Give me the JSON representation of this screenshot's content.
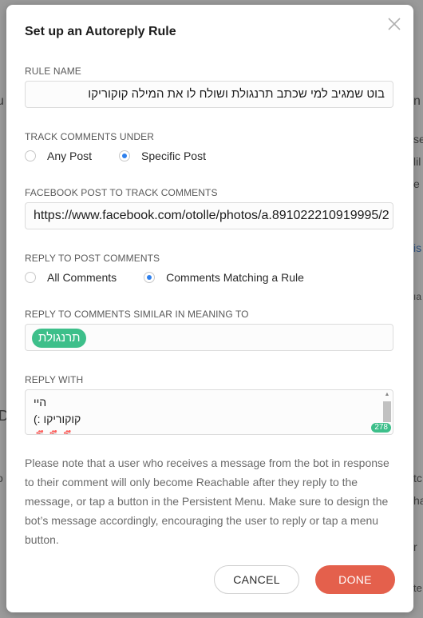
{
  "background_fragments": {
    "f1": "u",
    "f2": "n",
    "f3": "se",
    "f4": "lil",
    "f5": "e",
    "f6": "is",
    "f7": "ıa",
    "f8": "D",
    "f9": "tc",
    "f10": "o",
    "f11": "ha",
    "f12": "r",
    "f13": "te"
  },
  "modal": {
    "title": "Set up an Autoreply Rule",
    "close_icon": "close-icon"
  },
  "rule_name": {
    "label": "RULE NAME",
    "value": "בוט שמגיב למי שכתב תרנגולת ושולח לו את המילה קוקוריקו"
  },
  "track_comments": {
    "label": "TRACK COMMENTS UNDER",
    "options": [
      {
        "label": "Any Post",
        "selected": false
      },
      {
        "label": "Specific Post",
        "selected": true
      }
    ]
  },
  "facebook_post": {
    "label": "FACEBOOK POST TO TRACK COMMENTS",
    "value": "https://www.facebook.com/otolle/photos/a.891022210919995/2"
  },
  "reply_to": {
    "label": "REPLY TO POST COMMENTS",
    "options": [
      {
        "label": "All Comments",
        "selected": false
      },
      {
        "label": "Comments Matching a Rule",
        "selected": true
      }
    ]
  },
  "similar_meaning": {
    "label": "REPLY TO COMMENTS SIMILAR IN MEANING TO",
    "tags": [
      "תרנגולת"
    ]
  },
  "reply_with": {
    "label": "REPLY WITH",
    "lines": [
      "היי",
      "קוקוריקו :)",
      "🐔🐔🐔"
    ],
    "counter": "278"
  },
  "note": "Please note that a user who receives a message from the bot in response to their comment will only become Reachable after they reply to the message, or tap a button in the Persistent Menu. Make sure to design the bot’s message accordingly, encouraging the user to reply or tap a menu button.",
  "buttons": {
    "cancel": "CANCEL",
    "done": "DONE"
  },
  "colors": {
    "accent_green": "#3dbf8a",
    "primary_red": "#e4604c",
    "radio_blue": "#2f80ed"
  }
}
